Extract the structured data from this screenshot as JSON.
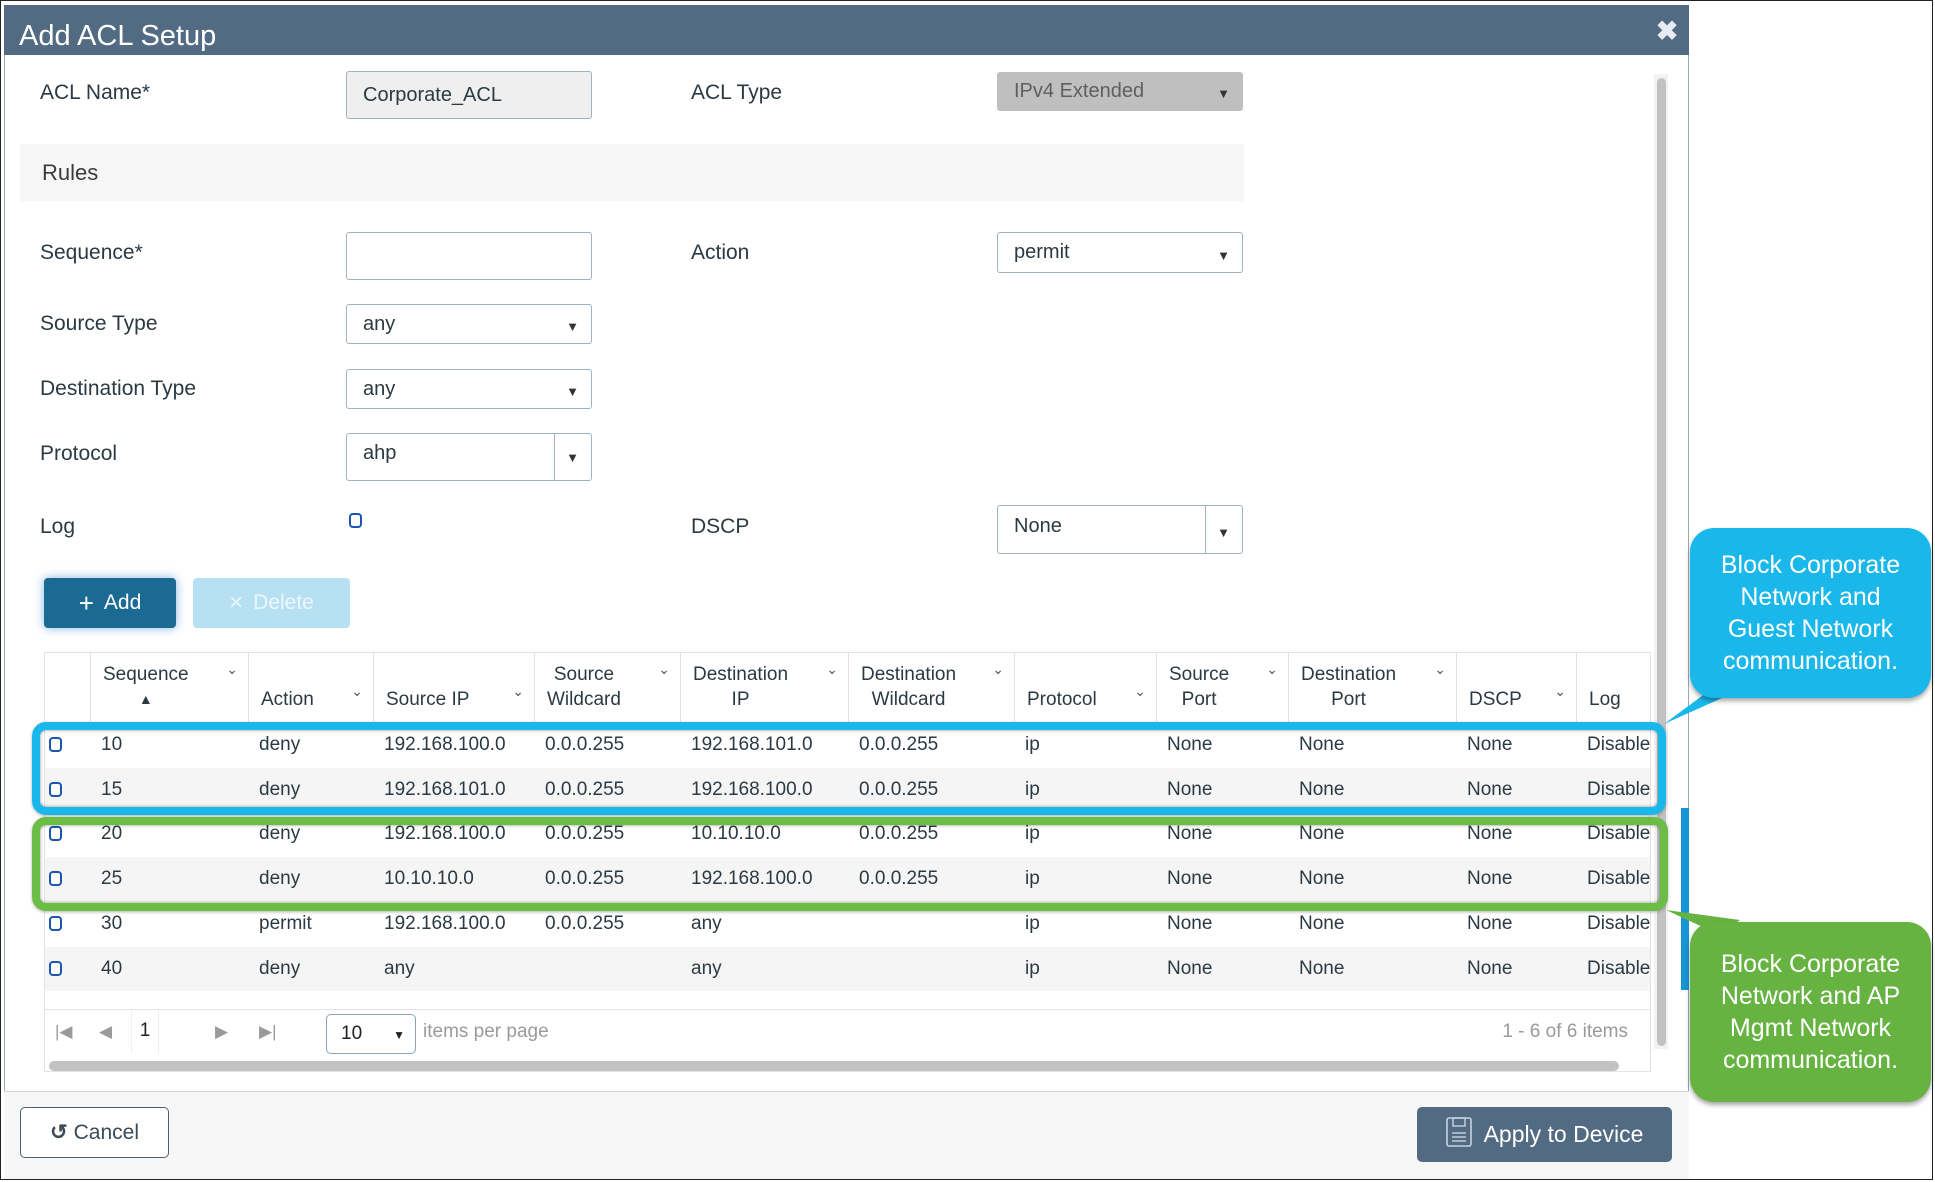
{
  "dialog": {
    "title": "Add ACL Setup",
    "close_icon": "close-icon"
  },
  "form": {
    "acl_name_label": "ACL Name*",
    "acl_name_value": "Corporate_ACL",
    "acl_type_label": "ACL Type",
    "acl_type_value": "IPv4 Extended",
    "rules_title": "Rules",
    "sequence_label": "Sequence*",
    "sequence_value": "",
    "action_label": "Action",
    "action_value": "permit",
    "source_type_label": "Source Type",
    "source_type_value": "any",
    "destination_type_label": "Destination Type",
    "destination_type_value": "any",
    "protocol_label": "Protocol",
    "protocol_value": "ahp",
    "log_label": "Log",
    "log_checked": false,
    "dscp_label": "DSCP",
    "dscp_value": "None"
  },
  "buttons": {
    "add": "Add",
    "add_icon": "+",
    "delete": "Delete",
    "delete_icon": "×",
    "cancel": "Cancel",
    "cancel_icon": "↺",
    "apply": "Apply to Device"
  },
  "table": {
    "columns": [
      {
        "line1": "Sequence",
        "line2": "▲"
      },
      {
        "line1": "",
        "line2": "Action"
      },
      {
        "line1": "",
        "line2": "Source IP"
      },
      {
        "line1": "Source",
        "line2": "Wildcard"
      },
      {
        "line1": "Destination",
        "line2": "IP"
      },
      {
        "line1": "Destination",
        "line2": "Wildcard"
      },
      {
        "line1": "",
        "line2": "Protocol"
      },
      {
        "line1": "Source",
        "line2": "Port"
      },
      {
        "line1": "Destination",
        "line2": "Port"
      },
      {
        "line1": "",
        "line2": "DSCP"
      },
      {
        "line1": "",
        "line2": "Log"
      }
    ],
    "sort_icon": "⌄",
    "rows": [
      [
        "10",
        "deny",
        "192.168.100.0",
        "0.0.0.255",
        "192.168.101.0",
        "0.0.0.255",
        "ip",
        "None",
        "None",
        "None",
        "Disable"
      ],
      [
        "15",
        "deny",
        "192.168.101.0",
        "0.0.0.255",
        "192.168.100.0",
        "0.0.0.255",
        "ip",
        "None",
        "None",
        "None",
        "Disable"
      ],
      [
        "20",
        "deny",
        "192.168.100.0",
        "0.0.0.255",
        "10.10.10.0",
        "0.0.0.255",
        "ip",
        "None",
        "None",
        "None",
        "Disable"
      ],
      [
        "25",
        "deny",
        "10.10.10.0",
        "0.0.0.255",
        "192.168.100.0",
        "0.0.0.255",
        "ip",
        "None",
        "None",
        "None",
        "Disable"
      ],
      [
        "30",
        "permit",
        "192.168.100.0",
        "0.0.0.255",
        "any",
        "",
        "ip",
        "None",
        "None",
        "None",
        "Disable"
      ],
      [
        "40",
        "deny",
        "any",
        "",
        "any",
        "",
        "ip",
        "None",
        "None",
        "None",
        "Disable"
      ]
    ]
  },
  "pagination": {
    "current_page": "1",
    "items_per_page": "10",
    "items_per_page_label": "items per page",
    "summary": "1 - 6 of 6 items"
  },
  "annotations": {
    "blue_callout": "Block Corporate Network and Guest Network communication.",
    "green_callout": "Block Corporate Network and AP Mgmt Network communication.",
    "blue_color": "#1ab7ea",
    "green_color": "#6cbd45"
  },
  "colors": {
    "header_bg": "#536b82",
    "primary_button": "#1b6a94",
    "disabled_button": "#b7e1f3"
  }
}
